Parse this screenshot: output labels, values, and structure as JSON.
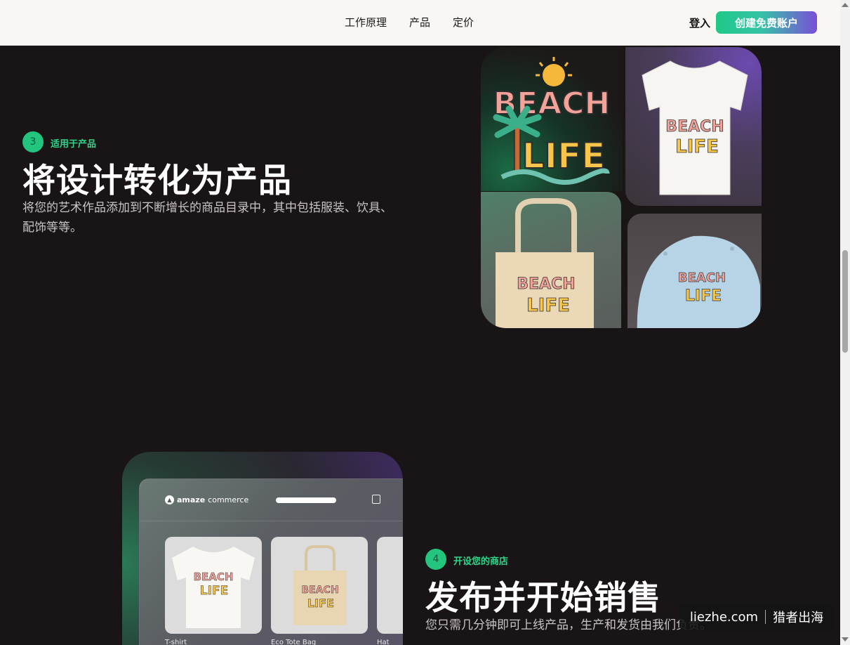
{
  "header": {
    "nav": [
      "工作原理",
      "产品",
      "定价"
    ],
    "login": "登入",
    "cta": "创建免费账户"
  },
  "step3": {
    "number": "3",
    "label": "适用于产品",
    "title": "将设计转化为产品",
    "description_line1": "将您的艺术作品添加到不断增长的商品目录中，其中包括服装、饮具、",
    "description_line2": "配饰等等。"
  },
  "artwork": {
    "word1": "BEACH",
    "word2": "LIFE"
  },
  "step4": {
    "number": "4",
    "label": "开设您的商店",
    "title": "发布并开始销售",
    "description": "您只需几分钟即可上线产品，生产和发货由我们负责。"
  },
  "store": {
    "logo_brand": "amaze",
    "logo_suffix": "commerce",
    "products": [
      {
        "label": "T-shirt"
      },
      {
        "label": "Eco Tote Bag"
      },
      {
        "label": "Hat"
      }
    ]
  },
  "watermark": {
    "site": "liezhe.com",
    "name": "猎者出海"
  },
  "colors": {
    "accent_green": "#23c47e",
    "accent_purple": "#7b4fd8",
    "background": "#191516"
  }
}
